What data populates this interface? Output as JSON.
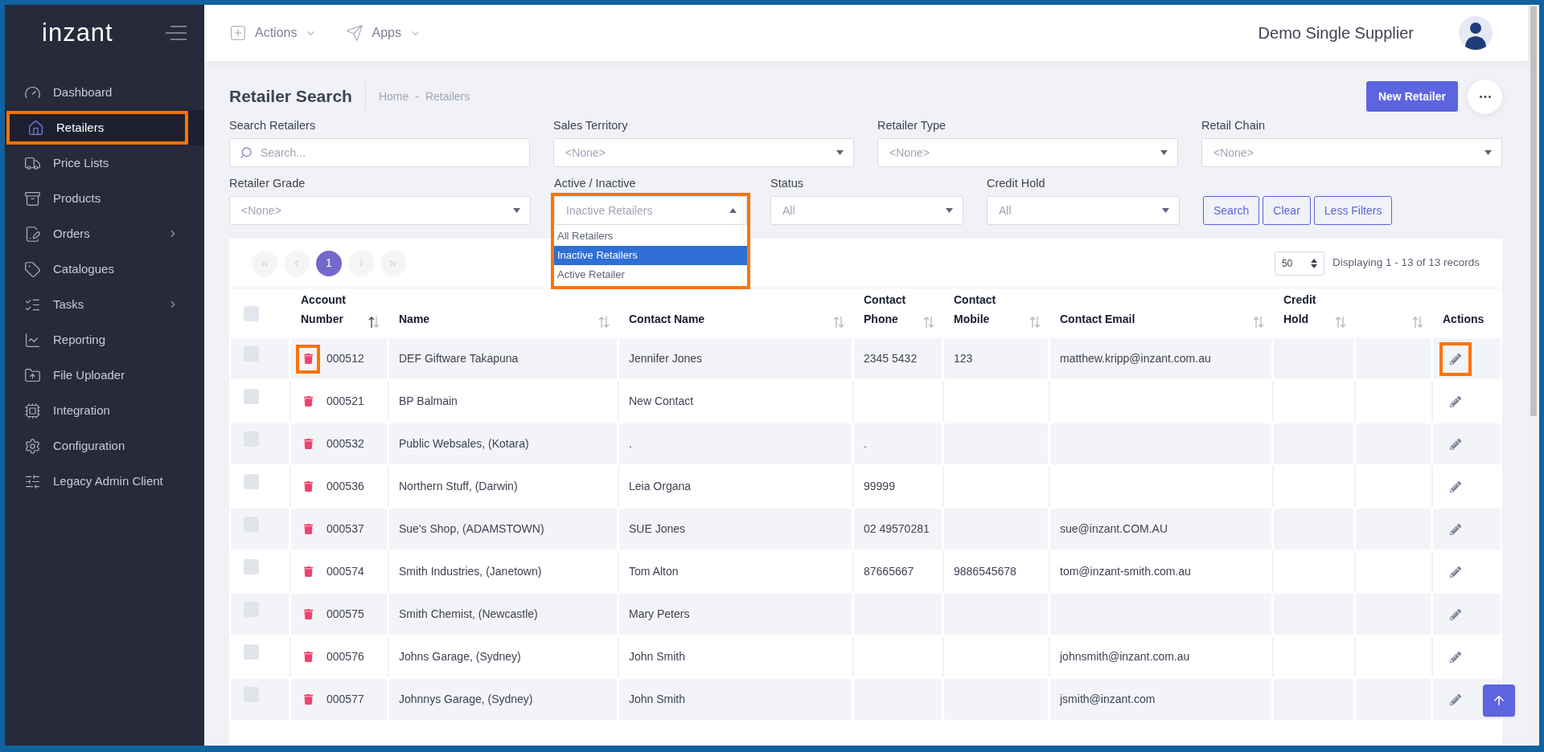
{
  "sidebar": {
    "logo": "inzant",
    "items": [
      {
        "label": "Dashboard",
        "selected": false,
        "has_submenu": false,
        "highlighted": false
      },
      {
        "label": "Retailers",
        "selected": true,
        "has_submenu": false,
        "highlighted": true
      },
      {
        "label": "Price Lists",
        "selected": false,
        "has_submenu": false,
        "highlighted": false
      },
      {
        "label": "Products",
        "selected": false,
        "has_submenu": false,
        "highlighted": false
      },
      {
        "label": "Orders",
        "selected": false,
        "has_submenu": true,
        "highlighted": false
      },
      {
        "label": "Catalogues",
        "selected": false,
        "has_submenu": false,
        "highlighted": false
      },
      {
        "label": "Tasks",
        "selected": false,
        "has_submenu": true,
        "highlighted": false
      },
      {
        "label": "Reporting",
        "selected": false,
        "has_submenu": false,
        "highlighted": false
      },
      {
        "label": "File Uploader",
        "selected": false,
        "has_submenu": false,
        "highlighted": false
      },
      {
        "label": "Integration",
        "selected": false,
        "has_submenu": false,
        "highlighted": false
      },
      {
        "label": "Configuration",
        "selected": false,
        "has_submenu": false,
        "highlighted": false
      },
      {
        "label": "Legacy Admin Client",
        "selected": false,
        "has_submenu": false,
        "highlighted": false
      }
    ]
  },
  "header": {
    "menus": [
      {
        "label": "Actions"
      },
      {
        "label": "Apps"
      }
    ],
    "account_name": "Demo Single Supplier"
  },
  "page": {
    "title": "Retailer Search",
    "breadcrumb": [
      "Home",
      "Retailers"
    ],
    "breadcrumb_separator": "-",
    "primary_button": "New Retailer"
  },
  "filters": [
    {
      "kind": "search",
      "label": "Search Retailers",
      "placeholder": "Search..."
    },
    {
      "kind": "select",
      "label": "Sales Territory",
      "value": "<None>"
    },
    {
      "kind": "select",
      "label": "Retailer Type",
      "value": "<None>"
    },
    {
      "kind": "select",
      "label": "Retail Chain",
      "value": "<None>"
    },
    {
      "kind": "select",
      "label": "Retailer Grade",
      "value": "<None>"
    },
    {
      "kind": "select",
      "label": "Active / Inactive",
      "value": "Inactive Retailers",
      "open": true,
      "highlighted": true,
      "options": [
        {
          "label": "All Retailers",
          "selected": false
        },
        {
          "label": "Inactive Retailers",
          "selected": true
        },
        {
          "label": "Active Retailer",
          "selected": false
        }
      ]
    },
    {
      "kind": "select",
      "label": "Status",
      "value": "All"
    },
    {
      "kind": "select",
      "label": "Credit Hold",
      "value": "All"
    }
  ],
  "filter_buttons": [
    "Search",
    "Clear",
    "Less Filters"
  ],
  "pagination": {
    "pages": [
      {
        "label": "1",
        "selected": true
      }
    ],
    "page_size": "50",
    "summary": "Displaying 1 - 13 of 13 records"
  },
  "table": {
    "select_all": {
      "checked": false
    },
    "columns": [
      {
        "label": "Account Number",
        "sortable": true,
        "sorted_ascending": true
      },
      {
        "label": "Name",
        "sortable": true,
        "sorted_ascending": false
      },
      {
        "label": "Contact Name",
        "sortable": true,
        "sorted_ascending": false
      },
      {
        "label": "Contact Phone",
        "sortable": true,
        "sorted_ascending": false
      },
      {
        "label": "Contact Mobile",
        "sortable": true,
        "sorted_ascending": false
      },
      {
        "label": "Contact Email",
        "sortable": true,
        "sorted_ascending": false
      },
      {
        "label": "Credit Hold",
        "sortable": true,
        "sorted_ascending": false
      },
      {
        "sortable": true,
        "sorted_ascending": false
      },
      {
        "label": "Actions",
        "sortable": false
      }
    ],
    "rows": [
      {
        "checked": false,
        "account": "000512",
        "name": "DEF Giftware Takapuna",
        "contact_name": "Jennifer Jones",
        "phone": "2345 5432",
        "mobile": "123",
        "email": "matthew.kripp@inzant.com.au",
        "delete_highlighted": true,
        "edit_highlighted": true
      },
      {
        "checked": false,
        "account": "000521",
        "name": "BP Balmain",
        "contact_name": "New Contact",
        "delete_highlighted": false,
        "edit_highlighted": false
      },
      {
        "checked": false,
        "account": "000532",
        "name": "Public Websales, (Kotara)",
        "contact_name": ".",
        "phone": ".",
        "delete_highlighted": false,
        "edit_highlighted": false
      },
      {
        "checked": false,
        "account": "000536",
        "name": "Northern Stuff, (Darwin)",
        "contact_name": "Leia Organa",
        "phone": "99999",
        "delete_highlighted": false,
        "edit_highlighted": false
      },
      {
        "checked": false,
        "account": "000537",
        "name": "Sue's Shop, (ADAMSTOWN)",
        "contact_name": "SUE Jones",
        "phone": "02 49570281",
        "email": "sue@inzant.COM.AU",
        "delete_highlighted": false,
        "edit_highlighted": false
      },
      {
        "checked": false,
        "account": "000574",
        "name": "Smith Industries, (Janetown)",
        "contact_name": "Tom Alton",
        "phone": "87665667",
        "mobile": "9886545678",
        "email": "tom@inzant-smith.com.au",
        "delete_highlighted": false,
        "edit_highlighted": false
      },
      {
        "checked": false,
        "account": "000575",
        "name": "Smith Chemist, (Newcastle)",
        "contact_name": "Mary Peters",
        "delete_highlighted": false,
        "edit_highlighted": false
      },
      {
        "checked": false,
        "account": "000576",
        "name": "Johns Garage, (Sydney)",
        "contact_name": "John Smith",
        "email": "johnsmith@inzant.com.au",
        "delete_highlighted": false,
        "edit_highlighted": false
      },
      {
        "checked": false,
        "account": "000577",
        "name": "Johnnys Garage, (Sydney)",
        "contact_name": "John Smith",
        "email": "jsmith@inzant.com",
        "delete_highlighted": false,
        "edit_highlighted": false
      }
    ]
  }
}
